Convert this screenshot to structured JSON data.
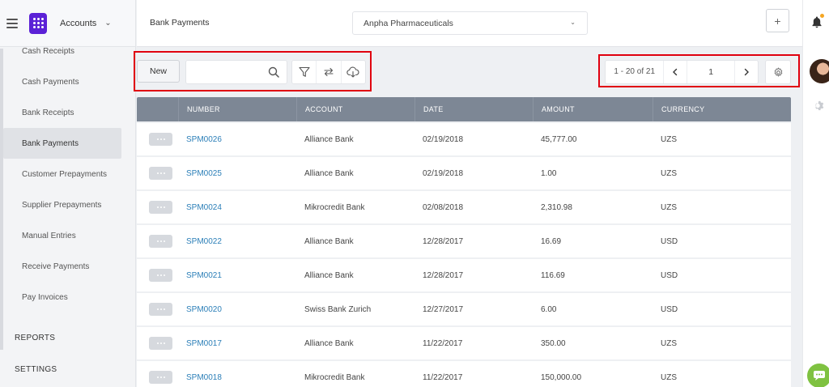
{
  "sidebar": {
    "module": "Accounts",
    "items": [
      {
        "label": "Cash Receipts"
      },
      {
        "label": "Cash Payments"
      },
      {
        "label": "Bank Receipts"
      },
      {
        "label": "Bank Payments"
      },
      {
        "label": "Customer Prepayments"
      },
      {
        "label": "Supplier Prepayments"
      },
      {
        "label": "Manual Entries"
      },
      {
        "label": "Receive Payments"
      },
      {
        "label": "Pay Invoices"
      }
    ],
    "active_item": "Bank Payments",
    "sections": [
      "REPORTS",
      "SETTINGS"
    ]
  },
  "header": {
    "page_title": "Bank Payments",
    "company": "Anpha Pharmaceuticals",
    "add_label": "+"
  },
  "toolbar": {
    "new_label": "New",
    "search_value": "",
    "icons": [
      "filter-icon",
      "swap-icon",
      "cloud-download-icon"
    ]
  },
  "pager": {
    "count": "1 - 20 of 21",
    "page": "1"
  },
  "table": {
    "columns": [
      "NUMBER",
      "ACCOUNT",
      "DATE",
      "AMOUNT",
      "CURRENCY"
    ],
    "rows": [
      {
        "number": "SPM0026",
        "account": "Alliance Bank",
        "date": "02/19/2018",
        "amount": "45,777.00",
        "currency": "UZS"
      },
      {
        "number": "SPM0025",
        "account": "Alliance Bank",
        "date": "02/19/2018",
        "amount": "1.00",
        "currency": "UZS"
      },
      {
        "number": "SPM0024",
        "account": "Mikrocredit Bank",
        "date": "02/08/2018",
        "amount": "2,310.98",
        "currency": "UZS"
      },
      {
        "number": "SPM0022",
        "account": "Alliance Bank",
        "date": "12/28/2017",
        "amount": "16.69",
        "currency": "USD"
      },
      {
        "number": "SPM0021",
        "account": "Alliance Bank",
        "date": "12/28/2017",
        "amount": "116.69",
        "currency": "USD"
      },
      {
        "number": "SPM0020",
        "account": "Swiss Bank Zurich",
        "date": "12/27/2017",
        "amount": "6.00",
        "currency": "USD"
      },
      {
        "number": "SPM0017",
        "account": "Alliance Bank",
        "date": "11/22/2017",
        "amount": "350.00",
        "currency": "UZS"
      },
      {
        "number": "SPM0018",
        "account": "Mikrocredit Bank",
        "date": "11/22/2017",
        "amount": "150,000.00",
        "currency": "UZS"
      }
    ]
  },
  "colors": {
    "brand": "#5b21d6",
    "table_header": "#7d8795",
    "link": "#2c7fb8",
    "highlight_box": "#e0000f",
    "chat": "#7fc241",
    "notification_dot": "#f5a623"
  }
}
